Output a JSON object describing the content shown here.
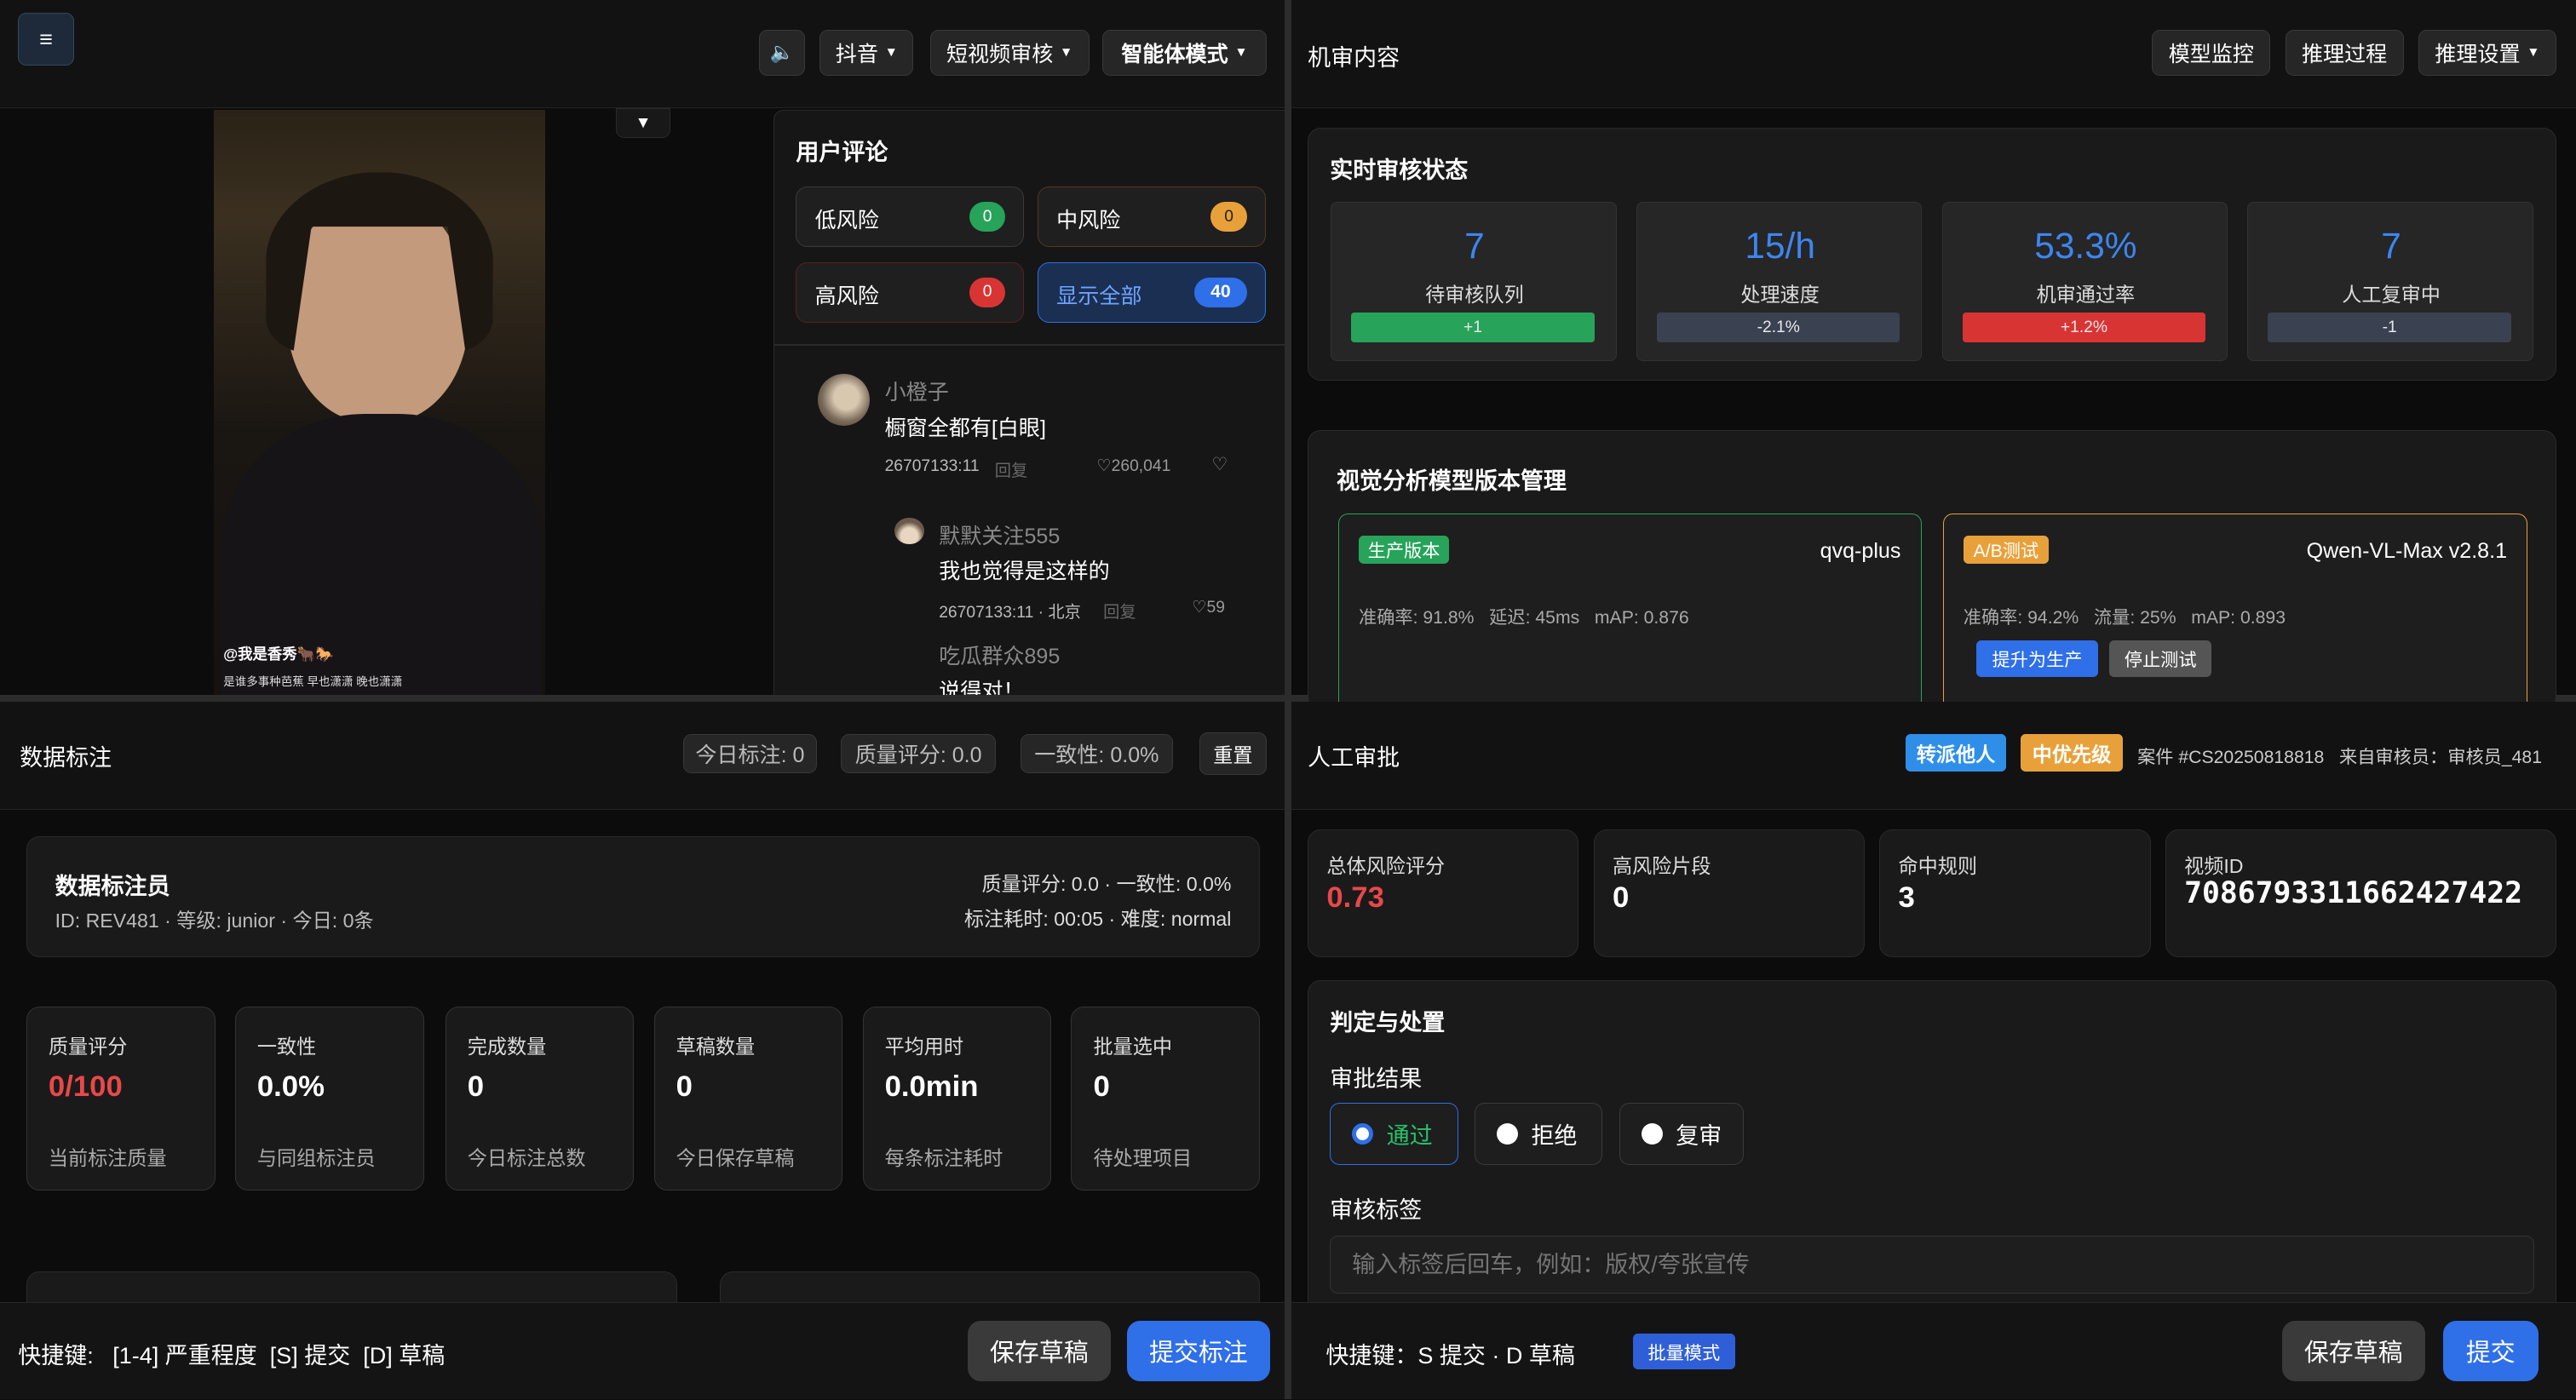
{
  "tl": {
    "platform": "抖音",
    "review_type": "短视频审核",
    "mode": "智能体模式",
    "video_caption_user": "@我是香秀🐂🐎",
    "video_caption_text": "是谁多事种芭蕉 早也潇潇 晚也潇潇"
  },
  "comments": {
    "title": "用户评论",
    "low_label": "低风险",
    "low_count": "0",
    "mid_label": "中风险",
    "mid_count": "0",
    "high_label": "高风险",
    "high_count": "0",
    "all_label": "显示全部",
    "all_count": "40",
    "c1_user": "小橙子",
    "c1_text": "橱窗全都有[白眼]",
    "c1_id": "26707133:11",
    "c1_reply": "回复",
    "c1_likes": "260,041",
    "c2_user": "默默关注555",
    "c2_text": "我也觉得是这样的",
    "c2_id": "26707133:11 · 北京",
    "c2_reply": "回复",
    "c2_likes": "59",
    "c3_user": "吃瓜群众895",
    "c3_text": "说得对！"
  },
  "tr": {
    "title": "机审内容",
    "btn_monitor": "模型监控",
    "btn_process": "推理过程",
    "btn_settings": "推理设置",
    "status_title": "实时审核状态",
    "stats": [
      {
        "value": "7",
        "label": "待审核队列",
        "delta": "+1"
      },
      {
        "value": "15/h",
        "label": "处理速度",
        "delta": "-2.1%"
      },
      {
        "value": "53.3%",
        "label": "机审通过率",
        "delta": "+1.2%"
      },
      {
        "value": "7",
        "label": "人工复审中",
        "delta": "-1"
      }
    ],
    "model_title": "视觉分析模型版本管理",
    "prod_tag": "生产版本",
    "prod_name": "qvq-plus",
    "prod_metrics": "准确率: 91.8%   延迟: 45ms   mAP: 0.876",
    "ab_tag": "A/B测试",
    "ab_name": "Qwen-VL-Max v2.8.1",
    "ab_metrics": "准确率: 94.2%   流量: 25%   mAP: 0.893",
    "ab_promote": "提升为生产",
    "ab_stop": "停止测试"
  },
  "bl": {
    "title": "数据标注",
    "today": "今日标注: 0",
    "quality": "质量评分: 0.0",
    "consistency": "一致性: 0.0%",
    "reset": "重置",
    "annotator_title": "数据标注员",
    "annotator_info": "ID: REV481 · 等级: junior · 今日: 0条",
    "annotator_right1": "质量评分: 0.0 · 一致性: 0.0%",
    "annotator_right2": "标注耗时: 00:05 · 难度: normal",
    "metrics": [
      {
        "label": "质量评分",
        "value": "0/100",
        "sub": "当前标注质量"
      },
      {
        "label": "一致性",
        "value": "0.0%",
        "sub": "与同组标注员"
      },
      {
        "label": "完成数量",
        "value": "0",
        "sub": "今日标注总数"
      },
      {
        "label": "草稿数量",
        "value": "0",
        "sub": "今日保存草稿"
      },
      {
        "label": "平均用时",
        "value": "0.0min",
        "sub": "每条标注耗时"
      },
      {
        "label": "批量选中",
        "value": "0",
        "sub": "待处理项目"
      }
    ],
    "shortcut": "快捷键:   [1-4] 严重程度  [S] 提交  [D] 草稿",
    "save_draft": "保存草稿",
    "submit": "提交标注"
  },
  "br": {
    "title": "人工审批",
    "transfer": "转派他人",
    "priority": "中优先级",
    "case_info": "案件 #CS20250818818   来自审核员：审核员_481",
    "risk_label": "总体风险评分",
    "risk_value": "0.73",
    "seg_label": "高风险片段",
    "seg_value": "0",
    "rule_label": "命中规则",
    "rule_value": "3",
    "vid_label": "视频ID",
    "vid_value": "7086793311662427422",
    "decision_title": "判定与处置",
    "result_label": "审批结果",
    "opt_pass": "通过",
    "opt_reject": "拒绝",
    "opt_review": "复审",
    "tags_label": "审核标签",
    "tags_placeholder": "输入标签后回车，例如：版权/夸张宣传",
    "shortcut": "快捷键：S 提交 · D 草稿",
    "batch": "批量模式",
    "save_draft": "保存草稿",
    "submit": "提交"
  },
  "colors": {
    "accent": "#2f6fe8",
    "green": "#27a35a",
    "red": "#d93434",
    "orange": "#e8a13a"
  }
}
